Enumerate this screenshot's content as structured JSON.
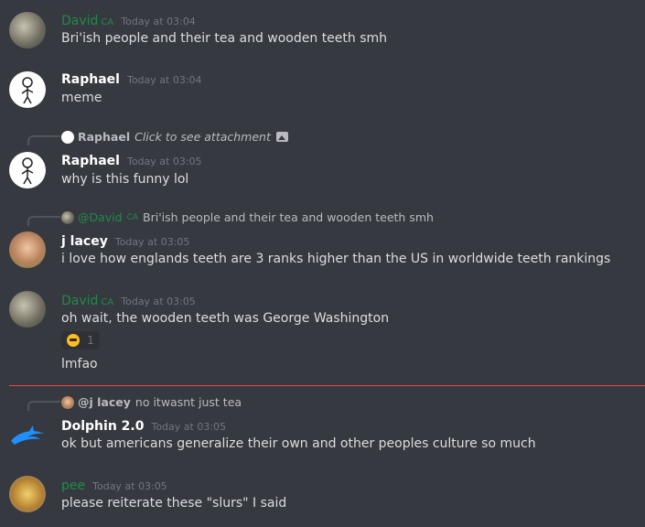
{
  "messages": [
    {
      "author": "David",
      "tag": "CA",
      "time": "Today at 03:04",
      "text": "Bri'ish people and their tea and wooden teeth smh"
    },
    {
      "author": "Raphael",
      "time": "Today at 03:04",
      "text": "meme"
    },
    {
      "reply": {
        "author": "Raphael",
        "text": "Click to see attachment"
      },
      "author": "Raphael",
      "time": "Today at 03:05",
      "text": "why is this funny lol"
    },
    {
      "reply": {
        "author": "@David",
        "tag": "CA",
        "text": "Bri'ish people and their tea and wooden teeth smh"
      },
      "author": "j lacey",
      "time": "Today at 03:05",
      "text": "i love how englands teeth are 3 ranks higher than the US in worldwide teeth rankings"
    },
    {
      "author": "David",
      "tag": "CA",
      "time": "Today at 03:05",
      "text": "oh wait, the wooden teeth was George Washington",
      "reaction_count": "1",
      "followup": "lmfao"
    },
    {
      "reply": {
        "author": "@j lacey",
        "text": "no itwasnt just tea"
      },
      "author": "Dolphin 2.0",
      "time": "Today at 03:05",
      "text": "ok but americans generalize their own and other peoples culture so much"
    },
    {
      "author": "pee",
      "time": "Today at 03:05",
      "text": "please reiterate these \"slurs\" I said"
    }
  ],
  "colors": {
    "background": "#36393f",
    "role_green": "#1f8b4c",
    "new_divider": "#f04747"
  }
}
